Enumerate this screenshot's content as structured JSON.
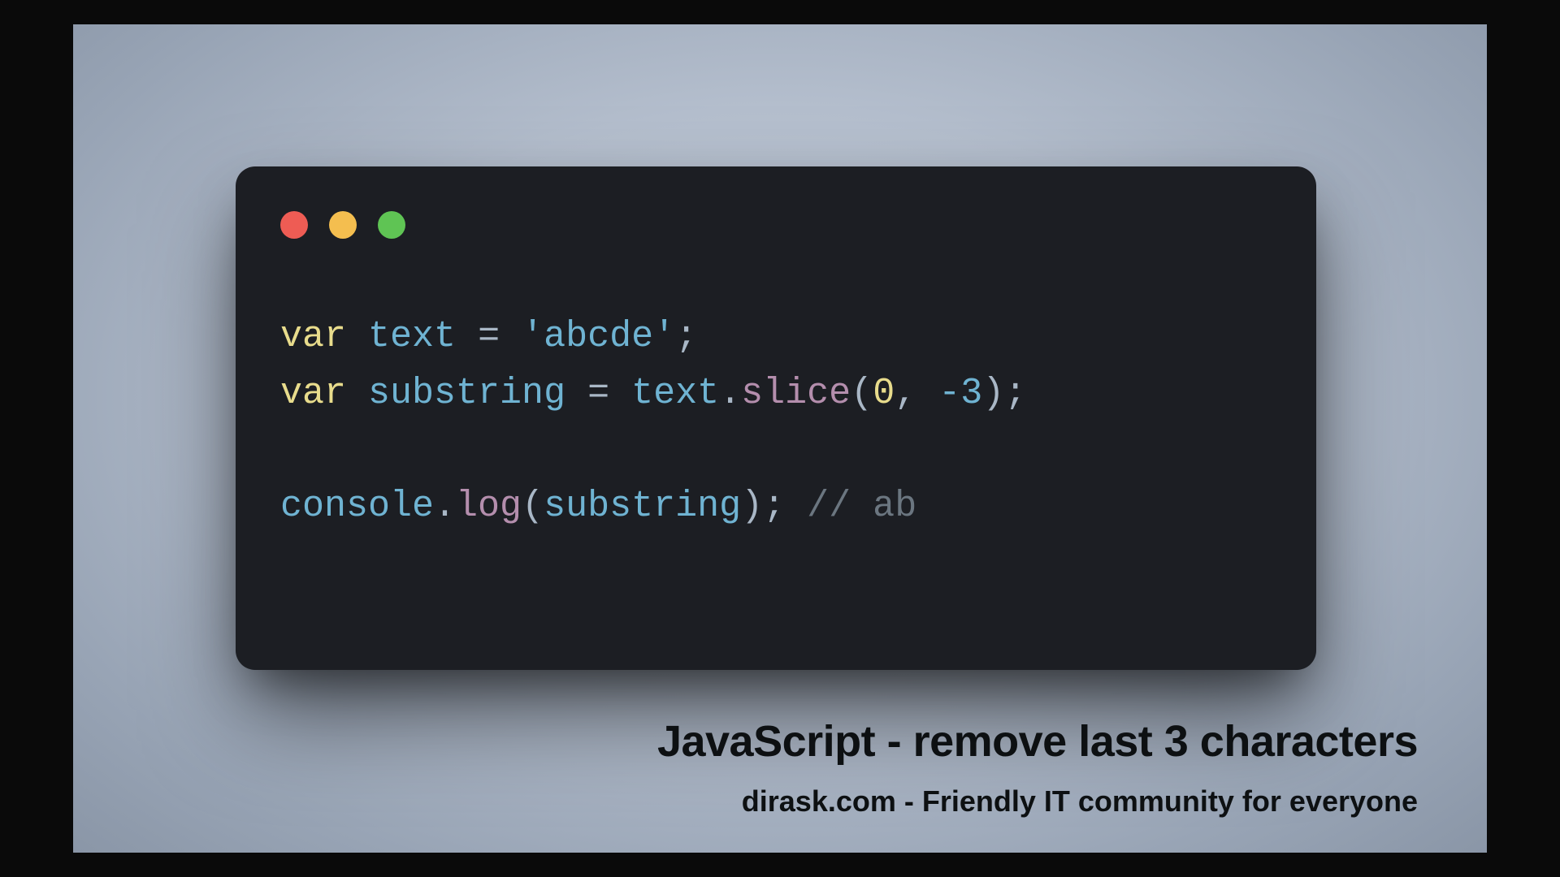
{
  "colors": {
    "traffic_red": "#ee5c54",
    "traffic_yellow": "#f4be4f",
    "traffic_green": "#5fc454",
    "window_bg": "#1c1e23",
    "stage_bg": "#b4becd"
  },
  "code": {
    "tokens": {
      "kw_var1": "var",
      "id_text1": "text",
      "eq1": " = ",
      "str1": "'abcde'",
      "semi1": ";",
      "kw_var2": "var",
      "id_sub": "substring",
      "eq2": " = ",
      "id_text2": "text",
      "dot1": ".",
      "m_slice": "slice",
      "open1": "(",
      "num_zero": "0",
      "comma": ", ",
      "num_neg3": "-3",
      "close1": ")",
      "semi2": ";",
      "id_console": "console",
      "dot2": ".",
      "m_log": "log",
      "open2": "(",
      "id_sub2": "substring",
      "close2": ")",
      "semi3": ";",
      "sp": " ",
      "comment": "// ab"
    }
  },
  "captions": {
    "title": "JavaScript - remove last 3 characters",
    "subtitle": "dirask.com - Friendly IT community for everyone"
  }
}
